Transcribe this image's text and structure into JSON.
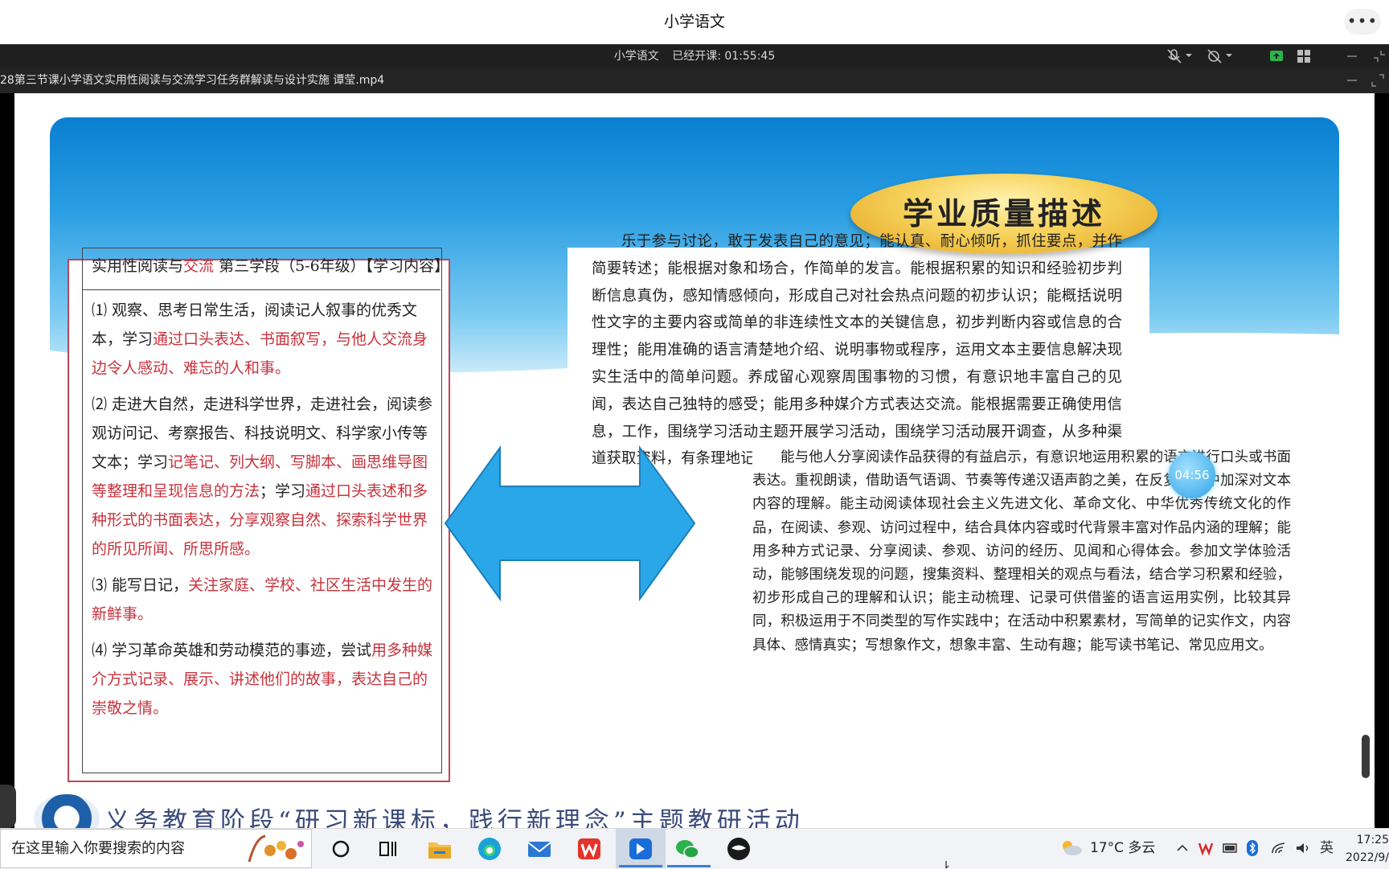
{
  "app": {
    "title": "小学语文",
    "more_label": "•••"
  },
  "meeting_bar": {
    "room": "小学语文",
    "elapsed": "已经开课: 01:55:45"
  },
  "file_bar": {
    "filename": "28第三节课小学语文实用性阅读与交流学习任务群解读与设计实施  谭莹.mp4"
  },
  "slide": {
    "heading": "学业质量描述",
    "left_box": {
      "title_parts": [
        "实用性阅读与",
        "交流",
        "  第三学段（5-6年级）【学习内容】"
      ],
      "items": [
        {
          "parts": [
            {
              "t": "⑴ 观察、思考日常生活，阅读记人叙事的优秀文本，学习",
              "red": false
            },
            {
              "t": "通过口头表达、书面叙写，与他人交流身边令人感动、难忘的人和事。",
              "red": true
            }
          ]
        },
        {
          "parts": [
            {
              "t": "⑵ 走进大自然，走进科学世界，走进社会，阅读参观访问记、考察报告、科技说明文、科学家小传等文本；学习",
              "red": false
            },
            {
              "t": "记笔记、列大纲、写脚本、画思维导图等整理和呈现信息的方法",
              "red": true
            },
            {
              "t": "；学习",
              "red": false
            },
            {
              "t": "通过口头表述和多种形式的书面表达，分享观察自然、探索科学世界的所见所闻、所思所感。",
              "red": true
            }
          ]
        },
        {
          "parts": [
            {
              "t": "⑶ 能写日记，",
              "red": false
            },
            {
              "t": "关注家庭、学校、社区生活中发生的新鲜事。",
              "red": true
            }
          ]
        },
        {
          "parts": [
            {
              "t": "⑷ 学习革命英雄和劳动模范的事迹，尝试",
              "red": false
            },
            {
              "t": "用多种媒介方式记录、展示、讲述他们的故事，表达自己的崇敬之情。",
              "red": true
            }
          ]
        }
      ]
    },
    "right_top": "乐于参与讨论，敢于发表自己的意见；能认真、耐心倾听，抓住要点，并作简要转述；能根据对象和场合，作简单的发言。能根据积累的知识和经验初步判断信息真伪，感知情感倾向，形成自己对社会热点问题的初步认识；能概括说明性文字的主要内容或简单的非连续性文本的关键信息，初步判断内容或信息的合理性；能用准确的语言清楚地介绍、说明事物或程序，运用文本主要信息解决现实生活中的简单问题。养成留心观察周围事物的习惯，有意识地丰富自己的见闻，表达自己独特的感受；能用多种媒介方式表达交流。能根据需要正确使用信息，工作，围绕学习活动主题开展学习活动，围绕学习活动展开调查，从多种渠道获取资料，有条理地记录学习活动过程。",
    "right_bottom": "能与他人分享阅读作品获得的有益启示，有意识地运用积累的语言进行口头或书面表达。重视朗读，借助语气语调、节奏等传递汉语声韵之美，在反复朗读中加深对文本内容的理解。能主动阅读体现社会主义先进文化、革命文化、中华优秀传统文化的作品，在阅读、参观、访问过程中，结合具体内容或时代背景丰富对作品内涵的理解；能用多种方式记录、分享阅读、参观、访问的经历、见闻和心得体会。参加文学体验活动，能够围绕发现的问题，搜集资料、整理相关的观点与看法，结合学习积累和经验，初步形成自己的理解和认识；能主动梳理、记录可供借鉴的语言运用实例，比较其异同，积极运用于不同类型的写作实践中；在活动中积累素材，写简单的记实作文，内容具体、感情真实；写想象作文，想象丰富、生动有趣；能写读书笔记、常见应用文。",
    "timer": "04:56",
    "footer": "义务教育阶段“研习新课标，践行新理念”主题教研活动"
  },
  "taskbar": {
    "search_placeholder": "在这里输入你要搜索的内容",
    "weather": "17°C  多云",
    "ime": "英",
    "time": "17:25",
    "date": "2022/9/"
  },
  "colors": {
    "accent_red": "#c8323c",
    "banner_blue": "#2a9ee3",
    "pill_gold": "#f6d25b",
    "arrow_blue": "#2aa7e8"
  }
}
